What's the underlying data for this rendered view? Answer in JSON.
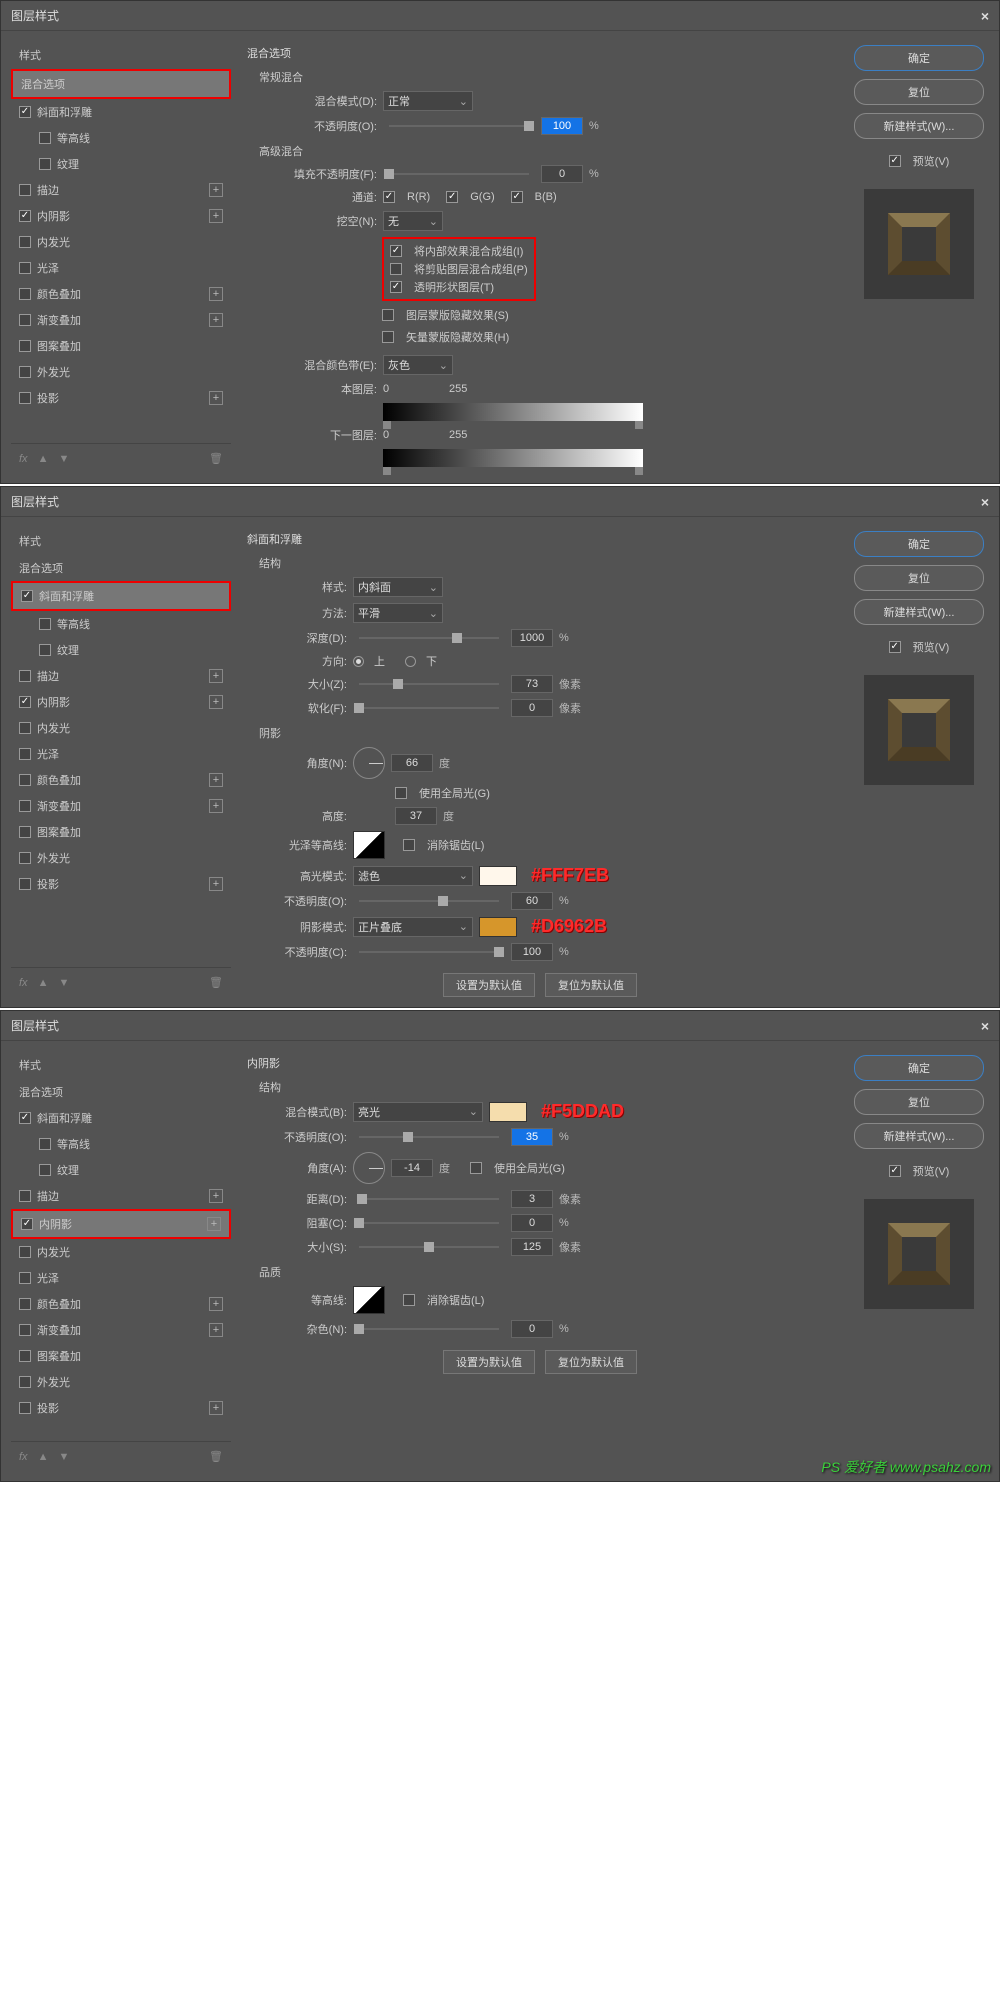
{
  "dialog_title": "图层样式",
  "close_symbol": "×",
  "buttons": {
    "ok": "确定",
    "reset": "复位",
    "new_style": "新建样式(W)...",
    "preview": "预览(V)",
    "set_default": "设置为默认值",
    "reset_default": "复位为默认值"
  },
  "left": {
    "title": "样式",
    "blending_options": "混合选项",
    "bevel": "斜面和浮雕",
    "contour": "等高线",
    "texture": "纹理",
    "stroke": "描边",
    "inner_shadow": "内阴影",
    "inner_glow": "内发光",
    "satin": "光泽",
    "color_overlay": "颜色叠加",
    "gradient_overlay": "渐变叠加",
    "pattern_overlay": "图案叠加",
    "outer_glow": "外发光",
    "drop_shadow": "投影",
    "fx": "fx"
  },
  "d1": {
    "title": "混合选项",
    "general": "常规混合",
    "blend_mode_label": "混合模式(D):",
    "blend_mode_value": "正常",
    "opacity_label": "不透明度(O):",
    "opacity_value": "100",
    "pct": "%",
    "advanced": "高级混合",
    "fill_opacity_label": "填充不透明度(F):",
    "fill_opacity_value": "0",
    "channels_label": "通道:",
    "ch_r": "R(R)",
    "ch_g": "G(G)",
    "ch_b": "B(B)",
    "knockout_label": "挖空(N):",
    "knockout_value": "无",
    "cb1": "将内部效果混合成组(I)",
    "cb2": "将剪贴图层混合成组(P)",
    "cb3": "透明形状图层(T)",
    "cb4": "图层蒙版隐藏效果(S)",
    "cb5": "矢量蒙版隐藏效果(H)",
    "blend_if_label": "混合颜色带(E):",
    "blend_if_value": "灰色",
    "this_layer": "本图层:",
    "v0": "0",
    "v255": "255",
    "under_layer": "下一图层:"
  },
  "d2": {
    "title": "斜面和浮雕",
    "structure": "结构",
    "style_label": "样式:",
    "style_value": "内斜面",
    "technique_label": "方法:",
    "technique_value": "平滑",
    "depth_label": "深度(D):",
    "depth_value": "1000",
    "pct": "%",
    "direction_label": "方向:",
    "dir_up": "上",
    "dir_down": "下",
    "size_label": "大小(Z):",
    "size_value": "73",
    "px": "像素",
    "soften_label": "软化(F):",
    "soften_value": "0",
    "shading": "阴影",
    "angle_label": "角度(N):",
    "angle_value": "66",
    "deg": "度",
    "global_light": "使用全局光(G)",
    "altitude_label": "高度:",
    "altitude_value": "37",
    "gloss_contour_label": "光泽等高线:",
    "anti_alias": "消除锯齿(L)",
    "highlight_mode_label": "高光模式:",
    "highlight_mode_value": "滤色",
    "highlight_opacity_label": "不透明度(O):",
    "highlight_opacity_value": "60",
    "shadow_mode_label": "阴影模式:",
    "shadow_mode_value": "正片叠底",
    "shadow_opacity_label": "不透明度(C):",
    "shadow_opacity_value": "100",
    "color_highlight": "#FFF7EB",
    "color_shadow": "#D6962B"
  },
  "d3": {
    "title": "内阴影",
    "structure": "结构",
    "blend_mode_label": "混合模式(B):",
    "blend_mode_value": "亮光",
    "opacity_label": "不透明度(O):",
    "opacity_value": "35",
    "pct": "%",
    "angle_label": "角度(A):",
    "angle_value": "-14",
    "deg": "度",
    "global_light": "使用全局光(G)",
    "distance_label": "距离(D):",
    "distance_value": "3",
    "px": "像素",
    "choke_label": "阻塞(C):",
    "choke_value": "0",
    "size_label": "大小(S):",
    "size_value": "125",
    "quality": "品质",
    "contour_label": "等高线:",
    "anti_alias": "消除锯齿(L)",
    "noise_label": "杂色(N):",
    "noise_value": "0",
    "color": "#F5DDAD"
  },
  "watermark": "PS 爱好者 www.psahz.com"
}
